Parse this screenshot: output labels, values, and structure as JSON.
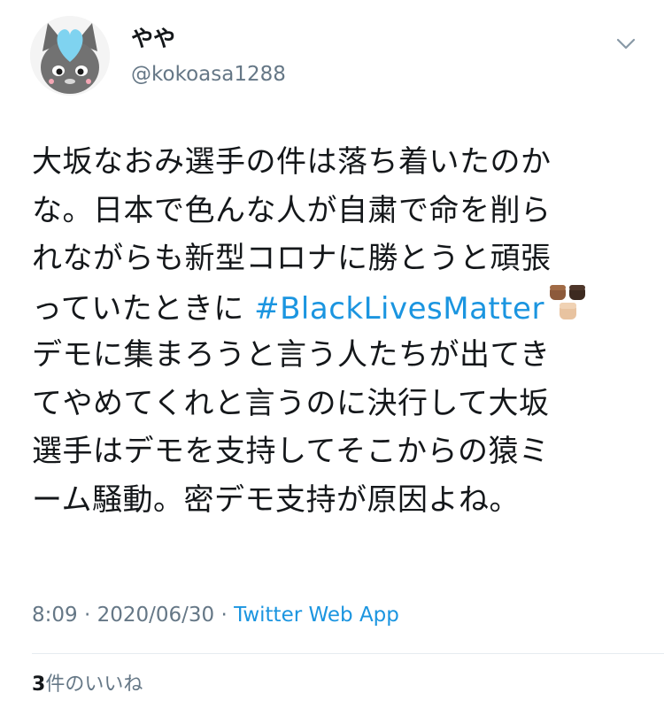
{
  "tweet": {
    "author": {
      "display_name": "やや",
      "handle": "@kokoasa1288",
      "avatar_icon": "cat-with-heart-avatar-icon"
    },
    "menu_icon": "chevron-down-icon",
    "text": {
      "line1": "大坂なおみ選手の件は落ち着いたのか",
      "line2": "な。日本で色んな人が自粛で命を削ら",
      "line3": "れながらも新型コロナに勝とうと頑張",
      "line4_before": "っていたときに ",
      "hashtag": "#BlackLivesMatter",
      "hashtag_emoji_icon": "raised-fist-emoji-icon",
      "line5": "デモに集まろうと言う人たちが出てき",
      "line6": "てやめてくれと言うのに決行して大坂",
      "line7": "選手はデモを支持してそこからの猿ミ",
      "line8": "ーム騒動。密デモ支持が原因よね。"
    },
    "timestamp": "8:09 · 2020/06/30 · ",
    "source": "Twitter Web App",
    "likes_count": "3",
    "likes_label": "件のいいね"
  },
  "colors": {
    "link": "#1b95e0",
    "secondary_text": "#657786",
    "primary_text": "#14171a",
    "avatar_heart": "#7fd3f0"
  }
}
